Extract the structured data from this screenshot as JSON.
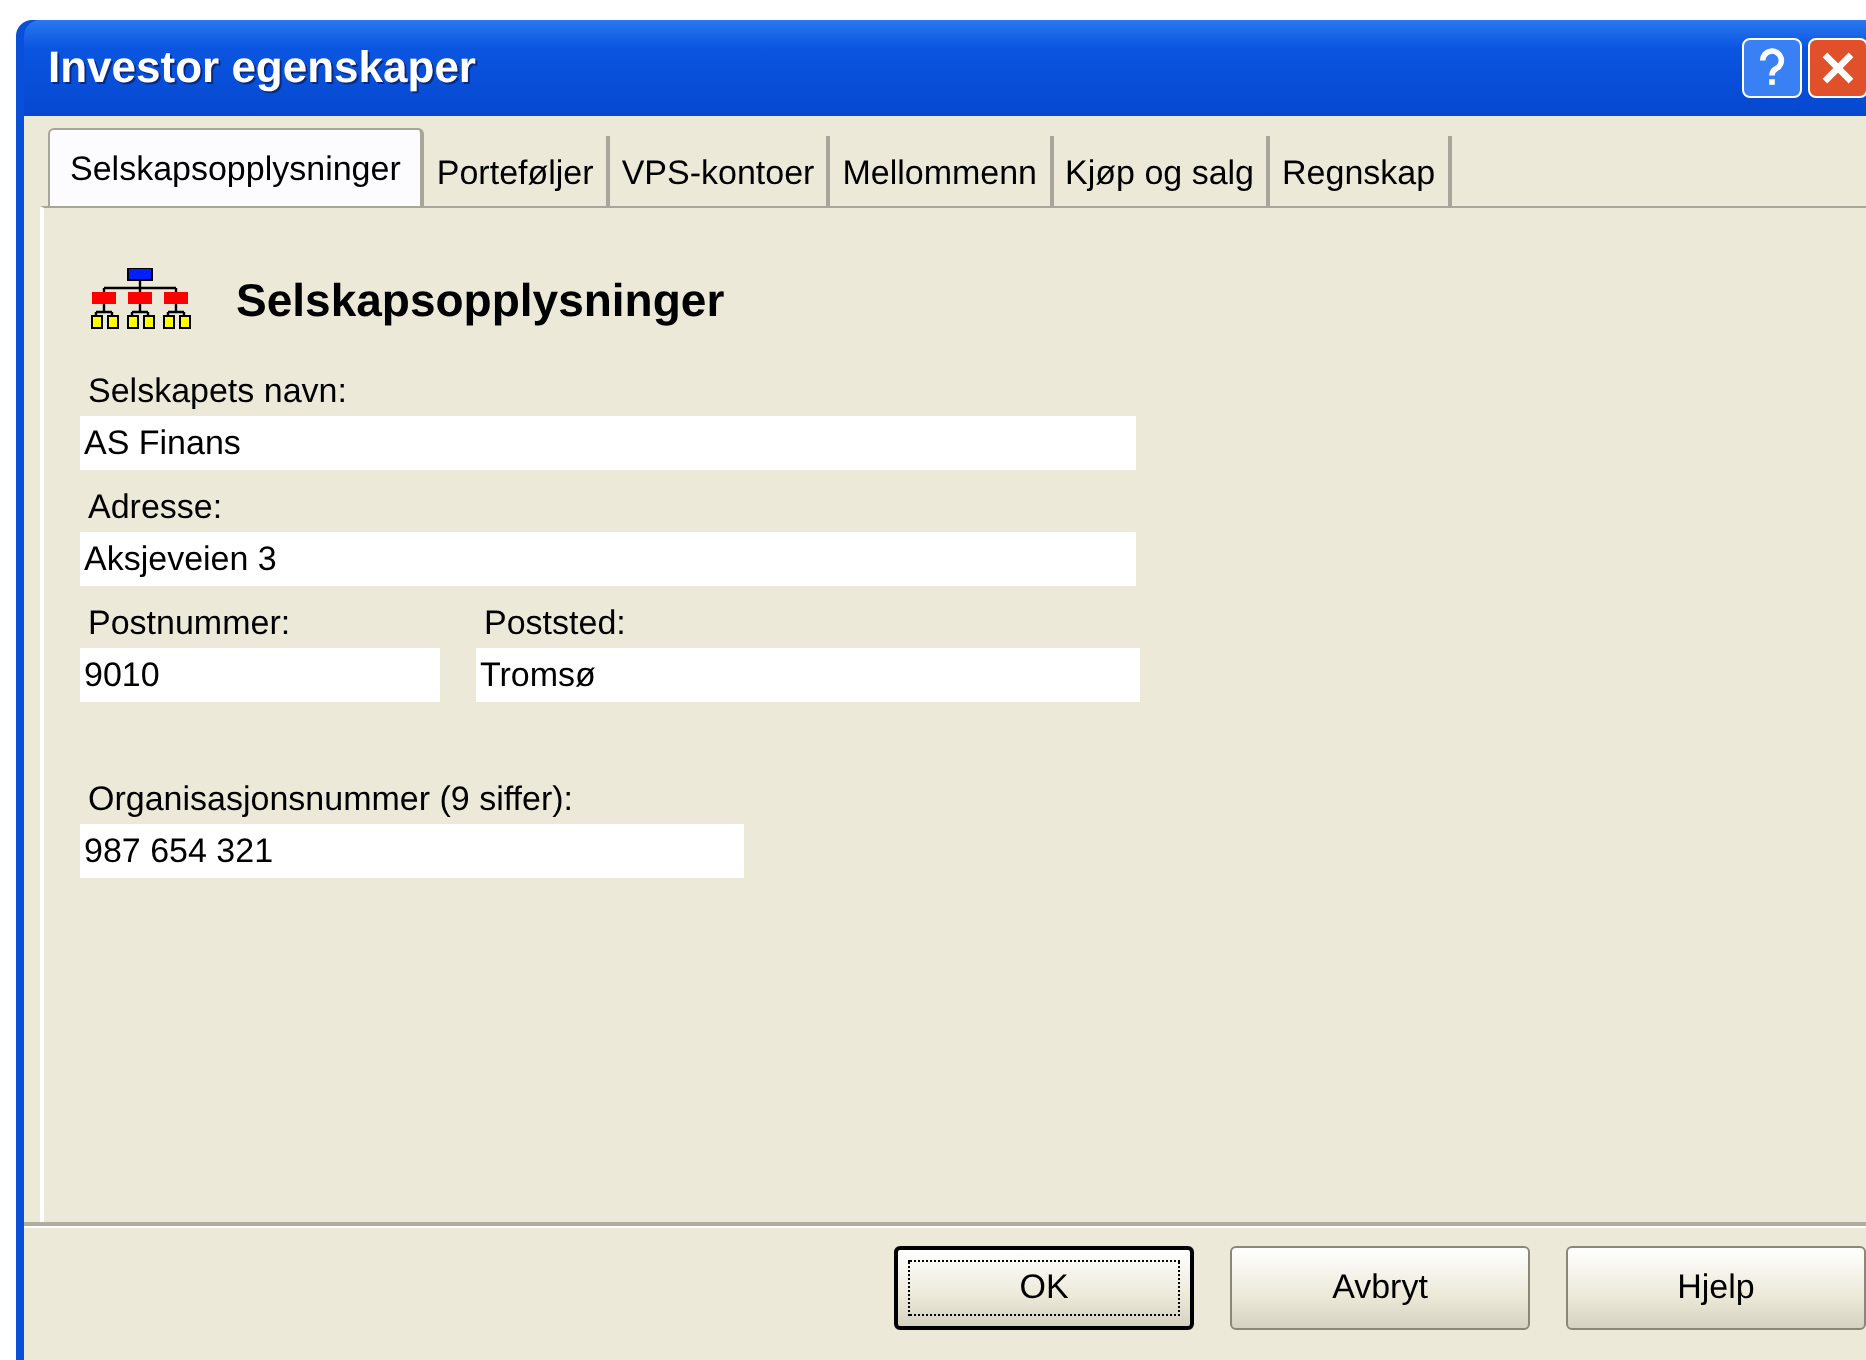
{
  "window": {
    "title": "Investor egenskaper"
  },
  "tabs": [
    {
      "label": "Selskapsopplysninger",
      "selected": true
    },
    {
      "label": "Porteføljer",
      "selected": false
    },
    {
      "label": "VPS-kontoer",
      "selected": false
    },
    {
      "label": "Mellommenn",
      "selected": false
    },
    {
      "label": "Kjøp og salg",
      "selected": false
    },
    {
      "label": "Regnskap",
      "selected": false
    }
  ],
  "heading": "Selskapsopplysninger",
  "company_fields": [
    {
      "label": "Selskapets navn:",
      "value": "AS Finans"
    },
    {
      "label": "Adresse:",
      "value": "Aksjeveien 3"
    }
  ],
  "postal_fields": [
    {
      "label": "Postnummer:",
      "value": "9010"
    },
    {
      "label": "Poststed:",
      "value": "Tromsø"
    }
  ],
  "org_number": {
    "label": "Organisasjonsnummer (9 siffer):",
    "value": "987 654 321"
  },
  "buttons": [
    {
      "label": "OK",
      "default": true
    },
    {
      "label": "Avbryt",
      "default": false
    },
    {
      "label": "Hjelp",
      "default": false
    }
  ]
}
